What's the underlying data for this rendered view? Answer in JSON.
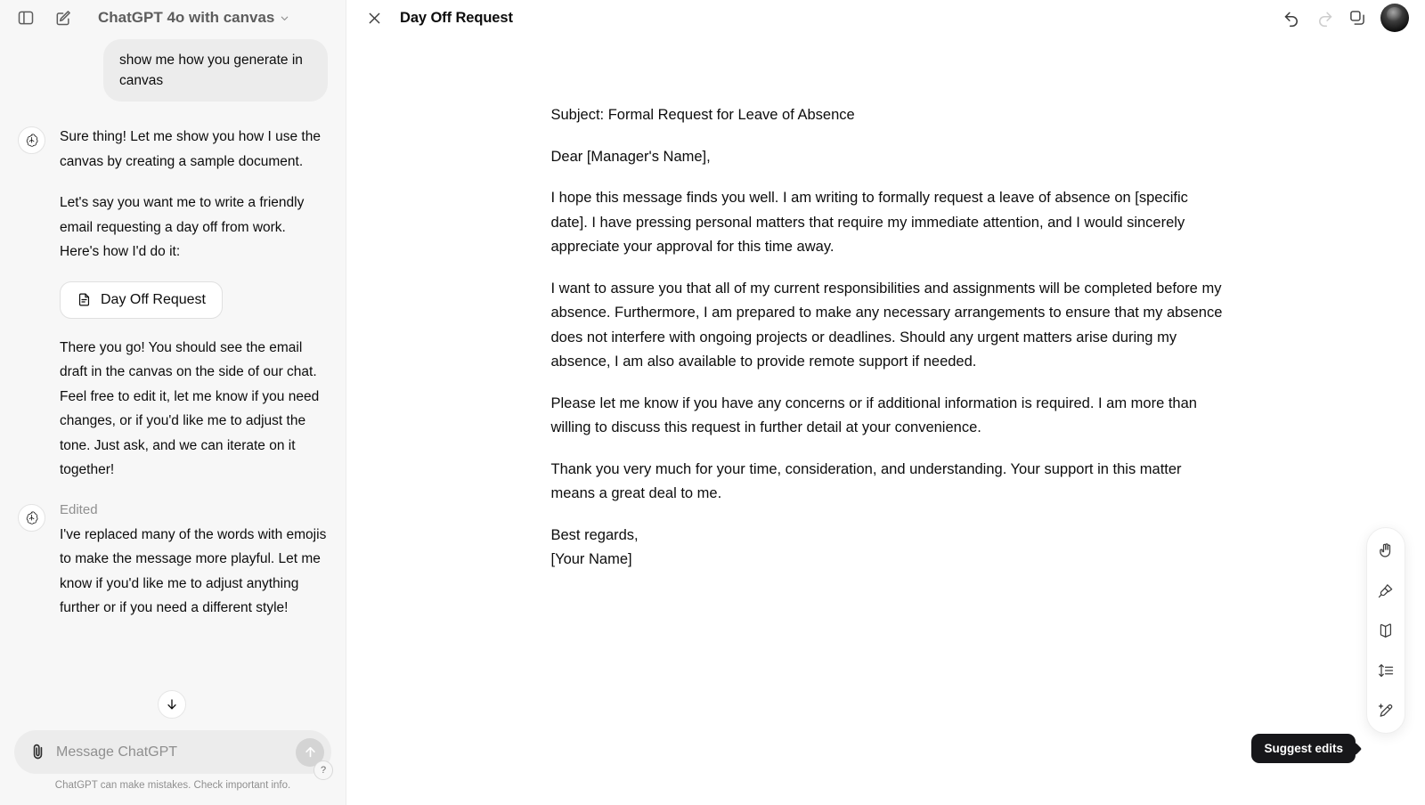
{
  "sidebar": {
    "toggle_sidebar_icon": "sidebar-panel-icon",
    "new_chat_icon": "compose-pencil-icon",
    "model_name": "ChatGPT 4o with canvas",
    "messages": [
      {
        "role": "user",
        "text": "show me how you generate in canvas"
      },
      {
        "role": "assistant",
        "paragraphs": [
          "Sure thing! Let me show you how I use the canvas by creating a sample document.",
          "Let's say you want me to write a friendly email requesting a day off from work. Here's how I'd do it:"
        ],
        "chip_label": "Day Off Request",
        "after_paragraphs": [
          "There you go! You should see the email draft in the canvas on the side of our chat. Feel free to edit it, let me know if you need changes, or if you'd like me to adjust the tone. Just ask, and we can iterate on it together!"
        ]
      },
      {
        "role": "assistant",
        "status_label": "Edited",
        "paragraphs": [
          "I've replaced many of the words with emojis to make the message more playful. Let me know if you'd like me to adjust anything further or if you need a different style!"
        ]
      }
    ],
    "composer": {
      "attach_icon": "paperclip-icon",
      "placeholder": "Message ChatGPT",
      "value": "",
      "send_icon": "arrow-up-icon"
    },
    "disclaimer": "ChatGPT can make mistakes. Check important info.",
    "help_label": "?",
    "scroll_down_icon": "arrow-down-icon"
  },
  "canvas": {
    "close_icon": "close-x-icon",
    "title": "Day Off Request",
    "header_actions": [
      {
        "name": "undo",
        "icon": "undo-arrow-icon",
        "disabled": false
      },
      {
        "name": "redo",
        "icon": "redo-arrow-icon",
        "disabled": true
      },
      {
        "name": "copy",
        "icon": "copy-icon",
        "disabled": false
      }
    ],
    "avatar_name": "user-avatar",
    "document": {
      "paragraphs": [
        "Subject: Formal Request for Leave of Absence",
        "Dear [Manager's Name],",
        "I hope this message finds you well. I am writing to formally request a leave of absence on [specific date]. I have pressing personal matters that require my immediate attention, and I would sincerely appreciate your approval for this time away.",
        "I want to assure you that all of my current responsibilities and assignments will be completed before my absence. Furthermore, I am prepared to make any necessary arrangements to ensure that my absence does not interfere with ongoing projects or deadlines. Should any urgent matters arise during my absence, I am also available to provide remote support if needed.",
        "Please let me know if you have any concerns or if additional information is required. I am more than willing to discuss this request in further detail at your convenience.",
        "Thank you very much for your time, consideration, and understanding. Your support in this matter means a great deal to me."
      ],
      "signoff_line_1": "Best regards,",
      "signoff_line_2": "[Your Name]"
    },
    "toolbar": {
      "items": [
        {
          "name": "add-emojis",
          "icon": "hand-emoji-icon"
        },
        {
          "name": "polish",
          "icon": "brush-icon"
        },
        {
          "name": "reading-level",
          "icon": "open-book-icon"
        },
        {
          "name": "adjust-length",
          "icon": "length-arrows-icon"
        },
        {
          "name": "suggest-edits",
          "icon": "sparkle-pencil-icon"
        }
      ],
      "active_tooltip": "Suggest edits"
    }
  },
  "colors": {
    "sidebar_bg": "#f7f7f7",
    "canvas_bg": "#ffffff",
    "user_bubble": "#ececec",
    "text_primary": "#0d0d0d",
    "text_muted": "#8f8f8f",
    "tooltip_bg": "#17171a"
  }
}
